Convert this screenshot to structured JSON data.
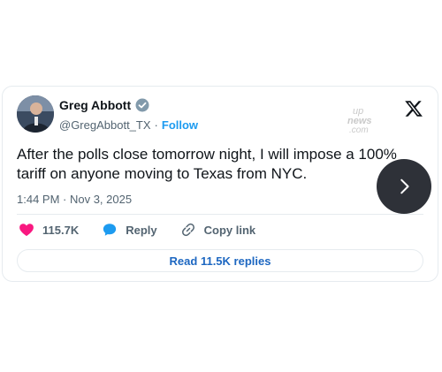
{
  "author": {
    "name": "Greg Abbott",
    "handle": "@GregAbbott_TX",
    "separator": "·",
    "follow_label": "Follow"
  },
  "tweet": {
    "text": "After the polls close tomorrow night, I will impose a 100% tariff on anyone moving to Texas from NYC.",
    "timestamp": "1:44 PM · Nov 3, 2025"
  },
  "actions": {
    "likes": "115.7K",
    "reply_label": "Reply",
    "copy_label": "Copy link"
  },
  "read_replies_label": "Read 11.5K replies",
  "watermark": "up.news.com",
  "colors": {
    "accent": "#1d9bf0",
    "like": "#f91880",
    "verified_badge": "#829aab",
    "next_button": "#2e3138"
  },
  "icons": [
    "verified-icon",
    "x-logo-icon",
    "heart-icon",
    "reply-bubble-icon",
    "link-icon",
    "chevron-right-icon"
  ]
}
